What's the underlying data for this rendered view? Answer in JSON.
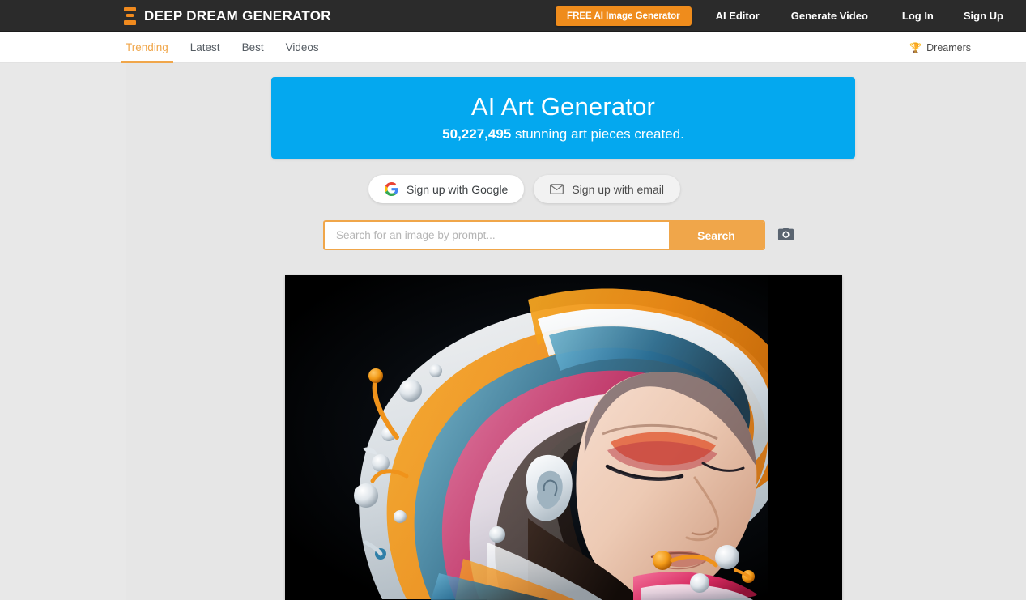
{
  "header": {
    "brand": {
      "icon": "hourglass-logo-icon",
      "text": "DEEP DREAM GENERATOR"
    },
    "cta": {
      "label": "FREE AI Image Generator",
      "color": "#ef8c1c"
    },
    "nav": [
      {
        "label": "AI Editor"
      },
      {
        "label": "Generate Video"
      },
      {
        "label": "Log In"
      },
      {
        "label": "Sign Up"
      }
    ],
    "background": "#2b2b2b"
  },
  "subnav": {
    "tabs": [
      {
        "label": "Trending",
        "active": true
      },
      {
        "label": "Latest",
        "active": false
      },
      {
        "label": "Best",
        "active": false
      },
      {
        "label": "Videos",
        "active": false
      }
    ],
    "active_color": "#f0a64a",
    "dreamers": {
      "icon": "trophy-icon",
      "label": "Dreamers"
    }
  },
  "hero": {
    "title": "AI Art Generator",
    "count": "50,227,495",
    "subtitle_rest": " stunning art pieces created.",
    "background": "#04a8ef"
  },
  "signup": {
    "google": {
      "icon": "google-g-icon",
      "label": "Sign up with Google"
    },
    "email": {
      "icon": "envelope-icon",
      "label": "Sign up with email"
    }
  },
  "search": {
    "placeholder": "Search for an image by prompt...",
    "value": "",
    "submit_label": "Search",
    "camera": {
      "icon": "camera-icon"
    },
    "accent": "#f0a64a"
  },
  "artwork": {
    "name": "featured-ai-artwork",
    "description": "Woman's face in profile with swirling multicolored 3D hair on black background",
    "background": "#000000"
  }
}
